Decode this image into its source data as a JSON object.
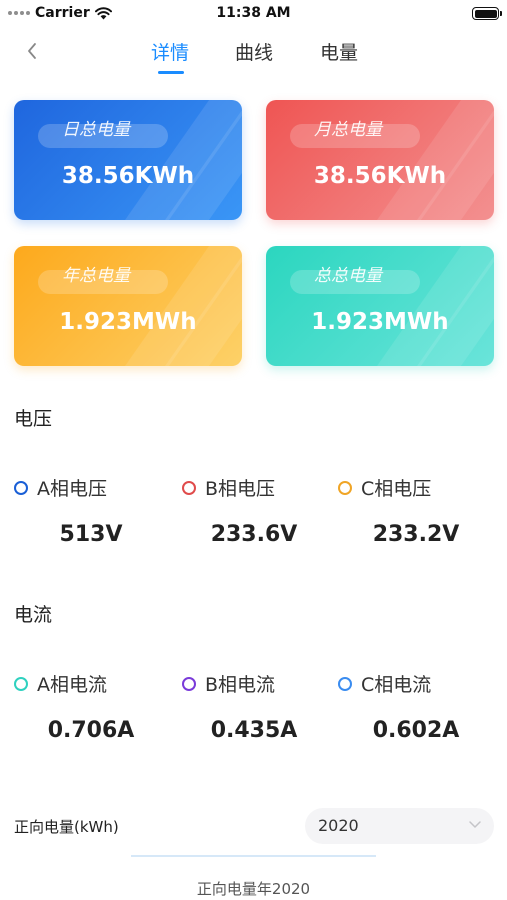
{
  "status_bar": {
    "carrier": "Carrier",
    "time": "11:38 AM"
  },
  "nav": {
    "tabs": [
      "详情",
      "曲线",
      "电量"
    ],
    "active_tab": 0
  },
  "cards": [
    {
      "label": "日总电量",
      "value": "38.56KWh"
    },
    {
      "label": "月总电量",
      "value": "38.56KWh"
    },
    {
      "label": "年总电量",
      "value": "1.923MWh"
    },
    {
      "label": "总总电量",
      "value": "1.923MWh"
    }
  ],
  "voltage": {
    "title": "电压",
    "items": [
      {
        "label": "A相电压",
        "value": "513V",
        "color": "#1a5fd6"
      },
      {
        "label": "B相电压",
        "value": "233.6V",
        "color": "#e04b4b"
      },
      {
        "label": "C相电压",
        "value": "233.2V",
        "color": "#f0a526"
      }
    ]
  },
  "current": {
    "title": "电流",
    "items": [
      {
        "label": "A相电流",
        "value": "0.706A",
        "color": "#2fd1bf"
      },
      {
        "label": "B相电流",
        "value": "0.435A",
        "color": "#7a3bd9"
      },
      {
        "label": "C相电流",
        "value": "0.602A",
        "color": "#3a8cf0"
      }
    ]
  },
  "energy": {
    "label": "正向电量(kWh)",
    "year_value": "2020",
    "chart_title": "正向电量年2020"
  },
  "colors": {
    "accent": "#1a8cff"
  }
}
